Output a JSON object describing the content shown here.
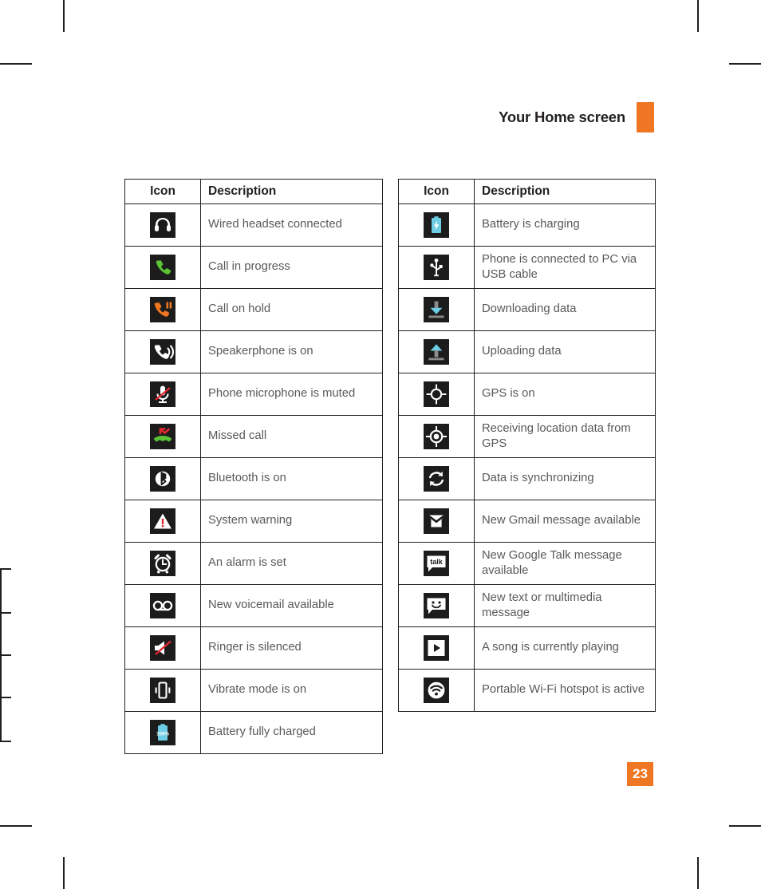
{
  "header": {
    "running_head": "Your Home screen",
    "accent_color": "#ef7622"
  },
  "page": {
    "number": "23",
    "badge_color": "#ef7622"
  },
  "tables": [
    {
      "id": "left",
      "columns": [
        "Icon",
        "Description"
      ],
      "rows": [
        {
          "icon": "headset-icon",
          "description": "Wired headset connected"
        },
        {
          "icon": "call-in-progress-icon",
          "description": "Call in progress"
        },
        {
          "icon": "call-on-hold-icon",
          "description": "Call on hold"
        },
        {
          "icon": "speakerphone-icon",
          "description": "Speakerphone is on"
        },
        {
          "icon": "mic-muted-icon",
          "description": "Phone microphone is muted"
        },
        {
          "icon": "missed-call-icon",
          "description": "Missed call"
        },
        {
          "icon": "bluetooth-icon",
          "description": "Bluetooth is on"
        },
        {
          "icon": "warning-icon",
          "description": "System warning"
        },
        {
          "icon": "alarm-clock-icon",
          "description": "An alarm is set"
        },
        {
          "icon": "voicemail-icon",
          "description": "New voicemail available"
        },
        {
          "icon": "ringer-silenced-icon",
          "description": "Ringer is silenced"
        },
        {
          "icon": "vibrate-icon",
          "description": "Vibrate mode is on"
        },
        {
          "icon": "battery-full-icon",
          "description": "Battery fully charged",
          "icon_text": "100%"
        }
      ]
    },
    {
      "id": "right",
      "columns": [
        "Icon",
        "Description"
      ],
      "rows": [
        {
          "icon": "battery-charging-icon",
          "description": "Battery is charging"
        },
        {
          "icon": "usb-icon",
          "description": "Phone is connected to PC via USB cable"
        },
        {
          "icon": "download-icon",
          "description": "Downloading data"
        },
        {
          "icon": "upload-icon",
          "description": "Uploading data"
        },
        {
          "icon": "gps-on-icon",
          "description": "GPS is on"
        },
        {
          "icon": "gps-fix-icon",
          "description": "Receiving location data from GPS"
        },
        {
          "icon": "sync-icon",
          "description": "Data is synchronizing"
        },
        {
          "icon": "gmail-icon",
          "description": "New Gmail message available"
        },
        {
          "icon": "google-talk-icon",
          "description": "New Google Talk message available",
          "icon_text": "talk"
        },
        {
          "icon": "sms-icon",
          "description": "New text or multimedia message"
        },
        {
          "icon": "play-icon",
          "description": "A song is currently playing"
        },
        {
          "icon": "wifi-hotspot-icon",
          "description": "Portable Wi-Fi hotspot is active"
        }
      ]
    }
  ],
  "colors": {
    "chip_background": "#1c1c1c",
    "accent_orange": "#ef7622",
    "status_blue": "#6ecde4",
    "status_green": "#5bc236",
    "status_red": "#e0282e",
    "status_gray": "#8c8c8c",
    "text_body": "#58595b",
    "text_heading": "#231f20"
  }
}
